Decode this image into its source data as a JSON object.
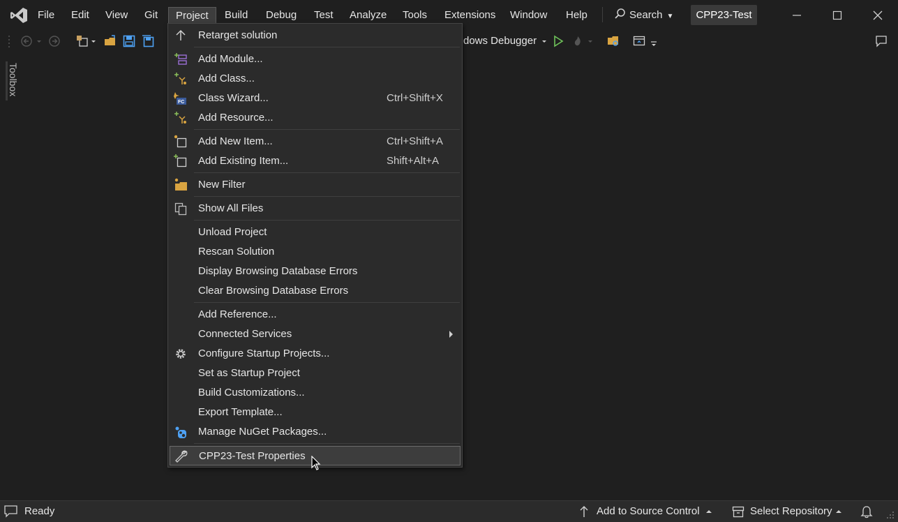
{
  "menubar": {
    "items": [
      "File",
      "Edit",
      "View",
      "Git",
      "Project",
      "Build",
      "Debug",
      "Test",
      "Analyze",
      "Tools",
      "Extensions",
      "Window",
      "Help"
    ],
    "search_label": "Search",
    "solution_name": "CPP23-Test"
  },
  "toolbar": {
    "debugger_label": "dows Debugger"
  },
  "toolbox": {
    "label": "Toolbox"
  },
  "project_menu": {
    "items": [
      {
        "label": "Retarget solution",
        "shortcut": ""
      },
      {
        "label": "Add Module...",
        "shortcut": ""
      },
      {
        "label": "Add Class...",
        "shortcut": ""
      },
      {
        "label": "Class Wizard...",
        "shortcut": "Ctrl+Shift+X"
      },
      {
        "label": "Add Resource...",
        "shortcut": ""
      },
      {
        "label": "Add New Item...",
        "shortcut": "Ctrl+Shift+A"
      },
      {
        "label": "Add Existing Item...",
        "shortcut": "Shift+Alt+A"
      },
      {
        "label": "New Filter",
        "shortcut": ""
      },
      {
        "label": "Show All Files",
        "shortcut": ""
      },
      {
        "label": "Unload Project",
        "shortcut": ""
      },
      {
        "label": "Rescan Solution",
        "shortcut": ""
      },
      {
        "label": "Display Browsing Database Errors",
        "shortcut": ""
      },
      {
        "label": "Clear Browsing Database Errors",
        "shortcut": ""
      },
      {
        "label": "Add Reference...",
        "shortcut": ""
      },
      {
        "label": "Connected Services",
        "shortcut": ""
      },
      {
        "label": "Configure Startup Projects...",
        "shortcut": ""
      },
      {
        "label": "Set as Startup Project",
        "shortcut": ""
      },
      {
        "label": "Build Customizations...",
        "shortcut": ""
      },
      {
        "label": "Export Template...",
        "shortcut": ""
      },
      {
        "label": "Manage NuGet Packages...",
        "shortcut": ""
      },
      {
        "label": "CPP23-Test Properties",
        "shortcut": ""
      }
    ]
  },
  "statusbar": {
    "ready": "Ready",
    "source_control": "Add to Source Control",
    "repository": "Select Repository"
  },
  "colors": {
    "background": "#1f1f1f",
    "menu_bg": "#2b2b2b",
    "accent_purple": "#9b6fd6",
    "accent_green": "#8bbf5a",
    "accent_blue": "#4ea1f3"
  }
}
